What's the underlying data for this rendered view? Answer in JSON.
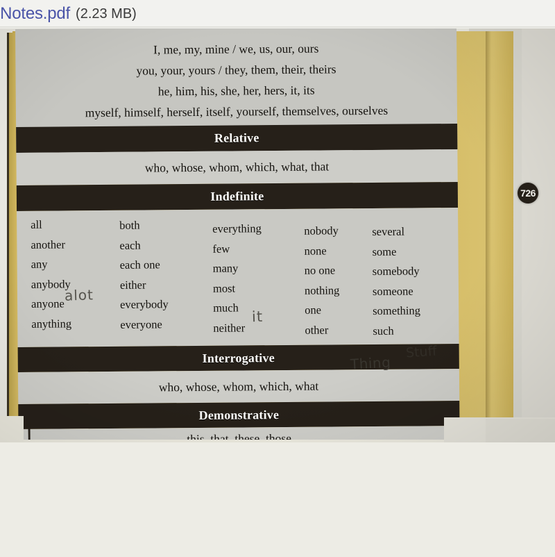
{
  "attachment": {
    "filename": "unsNotes.pdf",
    "filesize": "(2.23 MB)",
    "link_color": "#4a54a8"
  },
  "document": {
    "page_badge": "726",
    "personal_lines": [
      "I, me, my, mine / we, us, our, ours",
      "you, your, yours / they, them, their, theirs",
      "he, him, his, she, her, hers, it, its",
      "myself, himself, herself, itself, yourself, themselves, ourselves"
    ],
    "sections": {
      "relative_header": "Relative",
      "relative_values": "who, whose, whom, which, what, that",
      "indefinite_header": "Indefinite",
      "interrogative_header": "Interrogative",
      "interrogative_values": "who, whose, whom, which, what",
      "demonstrative_header": "Demonstrative",
      "demonstrative_values": "this, that, these, those"
    },
    "indefinite_columns": [
      [
        "all",
        "another",
        "any",
        "anybody",
        "anyone",
        "anything"
      ],
      [
        "both",
        "each",
        "each one",
        "either",
        "everybody",
        "everyone"
      ],
      [
        "everything",
        "few",
        "many",
        "most",
        "much",
        "neither"
      ],
      [
        "nobody",
        "none",
        "no one",
        "nothing",
        "one",
        "other"
      ],
      [
        "several",
        "some",
        "somebody",
        "someone",
        "something",
        "such"
      ]
    ],
    "handwritten_notes": [
      {
        "text": "alot",
        "near": "any"
      },
      {
        "text": "it",
        "near": "most"
      },
      {
        "text": "Thing",
        "near": "such"
      },
      {
        "text": "Stuff",
        "near": "such"
      }
    ],
    "red_mark": "✻",
    "colors": {
      "header_bar": "#262019",
      "table_light": "#c6c6c1",
      "page_yellow": "#d2b75f",
      "red_annotation": "#c2412c"
    }
  }
}
